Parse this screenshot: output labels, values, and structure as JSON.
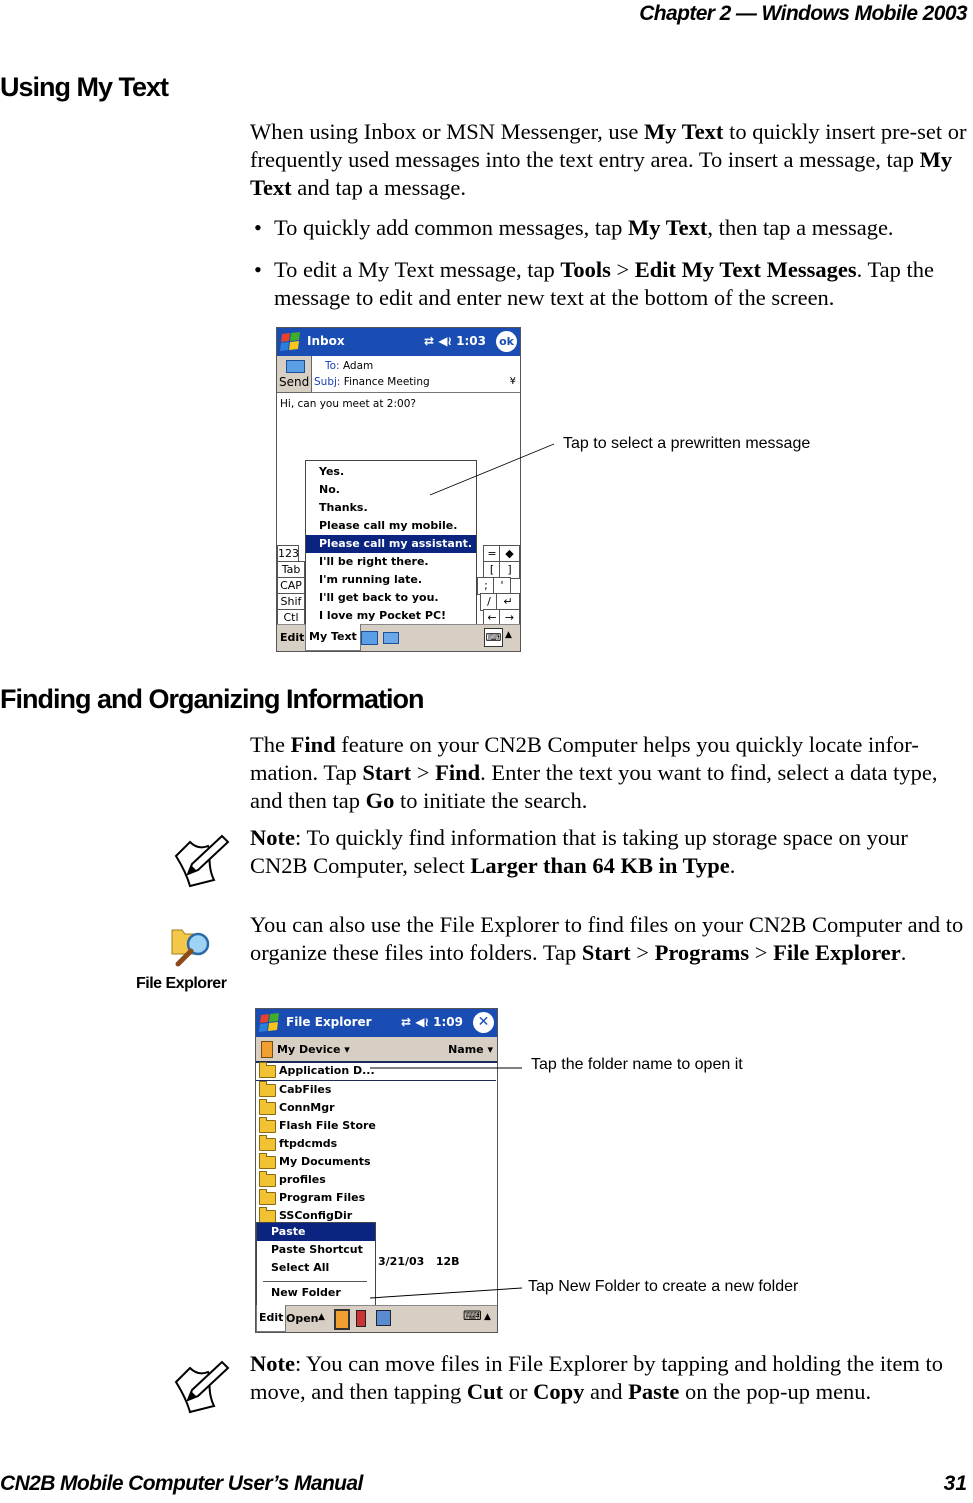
{
  "header": {
    "running_head": "Chapter 2 — Windows Mobile 2003"
  },
  "footer": {
    "manual_title": "CN2B Mobile Computer User’s Manual",
    "page_number": "31"
  },
  "section1": {
    "title": "Using My Text",
    "intro": {
      "t1": "When using Inbox or MSN Messenger, use ",
      "b1": "My Text",
      "t2": " to quickly insert pre-set or frequently used messages into the text entry area. To insert a message, tap ",
      "b2": "My Text",
      "t3": " and tap a message."
    },
    "bullets": [
      {
        "t1": "To quickly add common messages, tap ",
        "b1": "My Text",
        "t2": ", then tap a message."
      },
      {
        "t1": "To edit a My Text message, tap ",
        "b1": "Tools",
        "t2": " > ",
        "b2": "Edit My Text Messages",
        "t3": ". Tap the message to edit and enter new text at the bottom of the screen."
      }
    ],
    "screenshot": {
      "title": "Inbox",
      "time": "1:03",
      "ok_label": "ok",
      "send_label": "Send",
      "to_label": "To:",
      "to_value": "Adam",
      "subj_label": "Subj:",
      "subj_value": "Finance Meeting",
      "body_text": "Hi, can you meet at 2:00?",
      "keyboard_left_keys": [
        "123",
        "Tab",
        "CAP",
        "Shif",
        "Ctl"
      ],
      "keyboard_right_keys": [
        "=",
        "◆",
        "[",
        "]",
        ";",
        "'",
        "/",
        "↵",
        "←",
        "→"
      ],
      "my_text_items": [
        "Yes.",
        "No.",
        "Thanks.",
        "Please call my mobile.",
        "Please call my assistant.",
        "I'll be right there.",
        "I'm running late.",
        "I'll get back to you.",
        "I love my Pocket PC!"
      ],
      "selected_index": 4,
      "cmd_edit": "Edit",
      "cmd_mytext": "My Text",
      "callout": "Tap to select a prewritten message"
    }
  },
  "section2": {
    "title": "Finding and Organizing Information",
    "intro": {
      "t1": "The ",
      "b1": "Find",
      "t2": " feature on your CN2B Computer helps you quickly locate infor-mation. Tap ",
      "b2": "Start",
      "t3": " > ",
      "b3": "Find",
      "t4": ". Enter the text you want to find, select a data type, and then tap ",
      "b4": "Go",
      "t5": " to initiate the search."
    },
    "note1": {
      "b1": "Note",
      "t1": ": To quickly find information that is taking up storage space on your CN2B Computer, select ",
      "b2": "Larger than 64 KB in Type",
      "t2": "."
    },
    "file_explorer_icon_label": "File Explorer",
    "fe_para": {
      "t1": "You can also use the File Explorer to find files on your CN2B Computer and to organize these files into folders. Tap ",
      "b1": "Start",
      "t2": " > ",
      "b2": "Programs",
      "t3": " > ",
      "b3": "File Explorer",
      "t4": "."
    },
    "screenshot": {
      "title": "File Explorer",
      "time": "1:09",
      "location": "My Device",
      "sort": "Name",
      "folders": [
        "Application D...",
        "CabFiles",
        "ConnMgr",
        "Flash File Store",
        "ftpdcmds",
        "My Documents",
        "profiles",
        "Program Files",
        "SSConfigDir"
      ],
      "menu_items": [
        "Paste",
        "Paste Shortcut",
        "Select All",
        "New Folder"
      ],
      "selected_menu_index": 0,
      "file_date": "3/21/03",
      "file_size": "12B",
      "cmd_edit": "Edit",
      "cmd_open": "Open",
      "callout_top": "Tap the folder name to open it",
      "callout_bottom": "Tap New Folder to create a new folder"
    },
    "note2": {
      "b1": "Note",
      "t1": ": You can move files in File Explorer by tapping and holding the item to move, and then tapping ",
      "b2": "Cut",
      "t2": " or ",
      "b3": "Copy",
      "t3": " and ",
      "b4": "Paste",
      "t4": " on the pop-up menu."
    }
  },
  "colors": {
    "titlebar_blue": "#1a4db3",
    "selection_navy": "#0a2480",
    "command_bar": "#d8cfc4"
  }
}
